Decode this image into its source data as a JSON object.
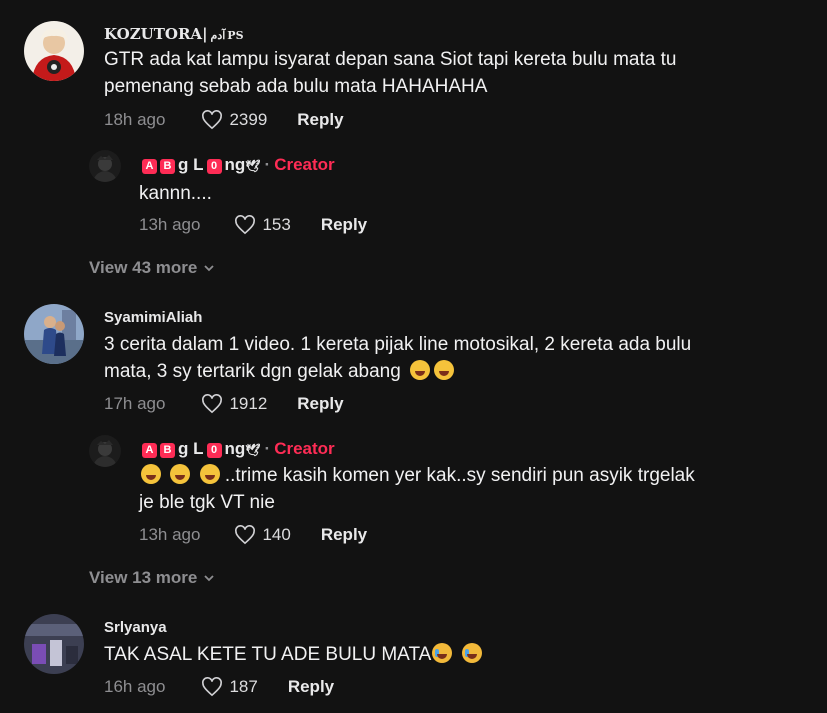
{
  "comments": [
    {
      "username": "KOZUTORA|",
      "username_arabic": "آدم",
      "username_suffix": "PS",
      "text_line1": "GTR ada kat lampu isyarat depan sana Siot tapi kereta bulu mata tu",
      "text_line2": "pemenang sebab ada bulu mata HAHAHAHA",
      "time": "18h ago",
      "likes": "2399",
      "reply_label": "Reply",
      "reply": {
        "name_badges": [
          "A",
          "B"
        ],
        "name_plain": "g L",
        "name_badge2": "0",
        "name_tail": "ng",
        "separator": "·",
        "creator_label": "Creator",
        "text": "kannn....",
        "time": "13h ago",
        "likes": "153",
        "reply_label": "Reply"
      },
      "view_more": "View 43 more"
    },
    {
      "username": "SyamimiAliah",
      "text_line1": "3 cerita dalam 1 video. 1 kereta pijak line motosikal, 2 kereta ada bulu",
      "text_line2": "mata, 3 sy tertarik dgn gelak abang",
      "time": "17h ago",
      "likes": "1912",
      "reply_label": "Reply",
      "reply": {
        "name_badges": [
          "A",
          "B"
        ],
        "name_plain": "g L",
        "name_badge2": "0",
        "name_tail": "ng",
        "separator": "·",
        "creator_label": "Creator",
        "text_line1": "..trime kasih komen yer kak..sy sendiri pun asyik trgelak",
        "text_line2": "je ble tgk VT nie",
        "time": "13h ago",
        "likes": "140",
        "reply_label": "Reply"
      },
      "view_more": "View 13 more"
    },
    {
      "username": "Srlyanya",
      "text_line1": "TAK ASAL KETE TU ADE BULU MATA",
      "time": "16h ago",
      "likes": "187",
      "reply_label": "Reply"
    }
  ],
  "icons": {
    "heart": "heart-outline-icon",
    "chevron": "chevron-down-icon",
    "emoji_laugh": "grinning-sweat-emoji",
    "emoji_rofl": "rofl-emoji",
    "emoji_cry": "crying-emoji"
  },
  "colors": {
    "background": "#121212",
    "creator": "#fe2c55",
    "muted": "#8e8e91",
    "text": "#f1f1f2"
  }
}
